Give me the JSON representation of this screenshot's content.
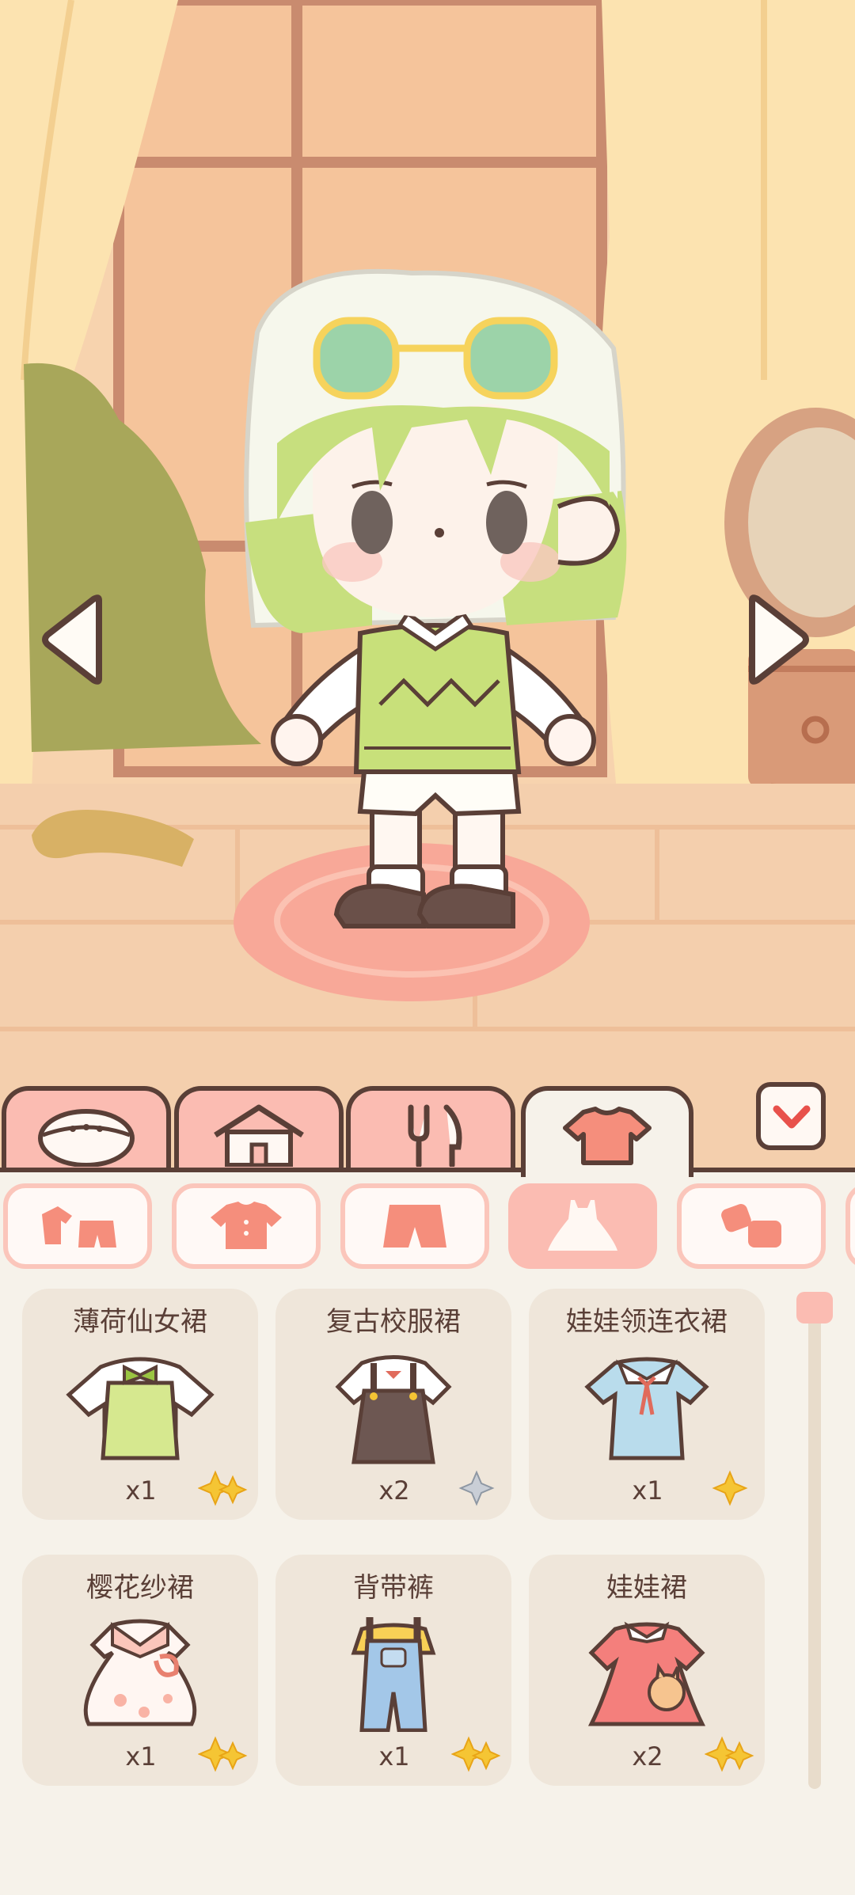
{
  "scene": {
    "prev_button_icon": "triangle-left-icon",
    "next_button_icon": "triangle-right-icon",
    "character_outfit": "薄荷仙女裙"
  },
  "tabs": [
    {
      "id": "face",
      "icon": "face-icon",
      "active": false
    },
    {
      "id": "home",
      "icon": "house-icon",
      "active": false
    },
    {
      "id": "food",
      "icon": "fork-knife-icon",
      "active": false
    },
    {
      "id": "clothes",
      "icon": "shirt-icon",
      "active": true
    }
  ],
  "collapse_icon": "chevron-down-icon",
  "categories": [
    {
      "id": "outfit-set",
      "icon": "outfit-set-icon",
      "active": false
    },
    {
      "id": "tops",
      "icon": "top-icon",
      "active": false
    },
    {
      "id": "bottoms",
      "icon": "shorts-icon",
      "active": false
    },
    {
      "id": "dresses",
      "icon": "dress-icon",
      "active": true
    },
    {
      "id": "shoes",
      "icon": "socks-icon",
      "active": false
    }
  ],
  "items": [
    {
      "name": "薄荷仙女裙",
      "count": "x1",
      "rarity": "gold-double"
    },
    {
      "name": "复古校服裙",
      "count": "x2",
      "rarity": "silver"
    },
    {
      "name": "娃娃领连衣裙",
      "count": "x1",
      "rarity": "gold"
    },
    {
      "name": "樱花纱裙",
      "count": "x1",
      "rarity": "gold-double"
    },
    {
      "name": "背带裤",
      "count": "x1",
      "rarity": "gold-double"
    },
    {
      "name": "娃娃裙",
      "count": "x2",
      "rarity": "gold-double"
    }
  ],
  "colors": {
    "outline": "#5a3f37",
    "accent_pink": "#fbbcb2",
    "card_bg": "#efe6da",
    "panel_bg": "#f6f2ea",
    "star_gold": "#f5c534"
  }
}
